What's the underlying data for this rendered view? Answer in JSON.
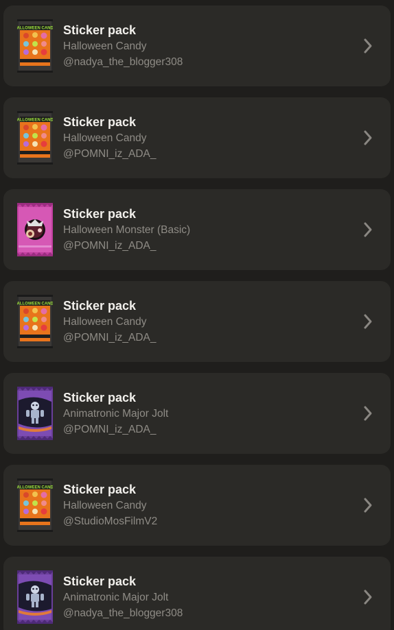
{
  "colors": {
    "background": "#1f1e1c",
    "card": "#2b2a27",
    "title": "#f2f0ec",
    "secondary": "#8f8c86",
    "chevron": "#8a8782"
  },
  "items": [
    {
      "type_label": "Sticker pack",
      "pack_name": "Halloween Candy",
      "author": "@nadya_the_blogger308",
      "icon": "halloween-candy-pack-icon"
    },
    {
      "type_label": "Sticker pack",
      "pack_name": "Halloween Candy",
      "author": "@POMNI_iz_ADA_",
      "icon": "halloween-candy-pack-icon"
    },
    {
      "type_label": "Sticker pack",
      "pack_name": "Halloween Monster (Basic)",
      "author": "@POMNI_iz_ADA_",
      "icon": "halloween-monster-pack-icon"
    },
    {
      "type_label": "Sticker pack",
      "pack_name": "Halloween Candy",
      "author": "@POMNI_iz_ADA_",
      "icon": "halloween-candy-pack-icon"
    },
    {
      "type_label": "Sticker pack",
      "pack_name": "Animatronic Major Jolt",
      "author": "@POMNI_iz_ADA_",
      "icon": "animatronic-pack-icon"
    },
    {
      "type_label": "Sticker pack",
      "pack_name": "Halloween Candy",
      "author": "@StudioMosFilmV2",
      "icon": "halloween-candy-pack-icon"
    },
    {
      "type_label": "Sticker pack",
      "pack_name": "Animatronic Major Jolt",
      "author": "@nadya_the_blogger308",
      "icon": "animatronic-pack-icon"
    }
  ]
}
